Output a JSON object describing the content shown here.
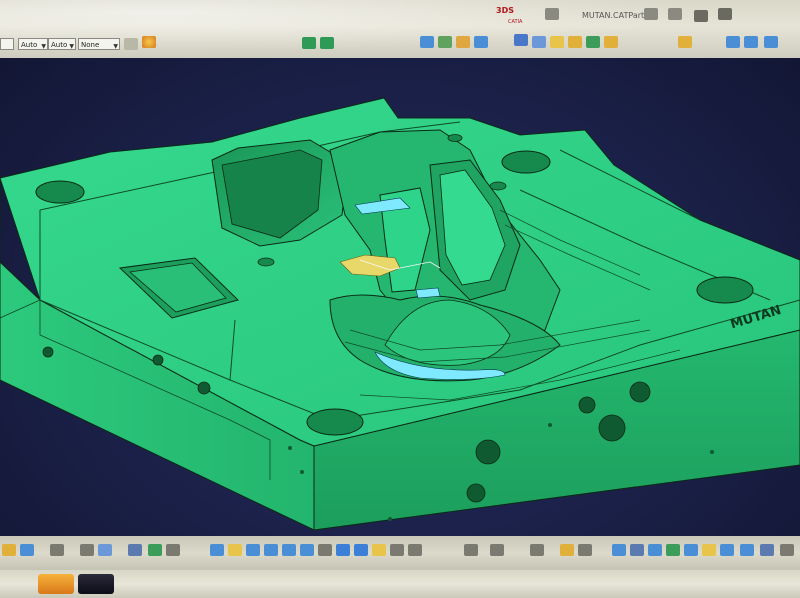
{
  "toolbar": {
    "combo_1": "Auto",
    "combo_2": "Auto",
    "combo_3": "None",
    "brand_logo": "3DS",
    "brand_sub": "CATIA",
    "doc_title": "MUTAN.CATPart"
  },
  "model": {
    "engraving": "MUTAN",
    "colors": {
      "mold_top": "#2fd387",
      "mold_side": "#22b46c",
      "mold_front": "#1f9f5f",
      "highlight": "#7fe9ff",
      "background": "#1b2046"
    }
  },
  "icons": [
    "arrow-up-icon",
    "zoom-icon",
    "rotate-icon",
    "pan-icon",
    "fit-all-icon",
    "normal-view-icon",
    "iso-view-icon",
    "shading-icon",
    "hide-show-icon",
    "measure-icon",
    "formula-icon",
    "sketch-icon",
    "axis-icon"
  ],
  "taskbar": {
    "app_1": "explorer-icon",
    "app_2": "catia-icon"
  }
}
